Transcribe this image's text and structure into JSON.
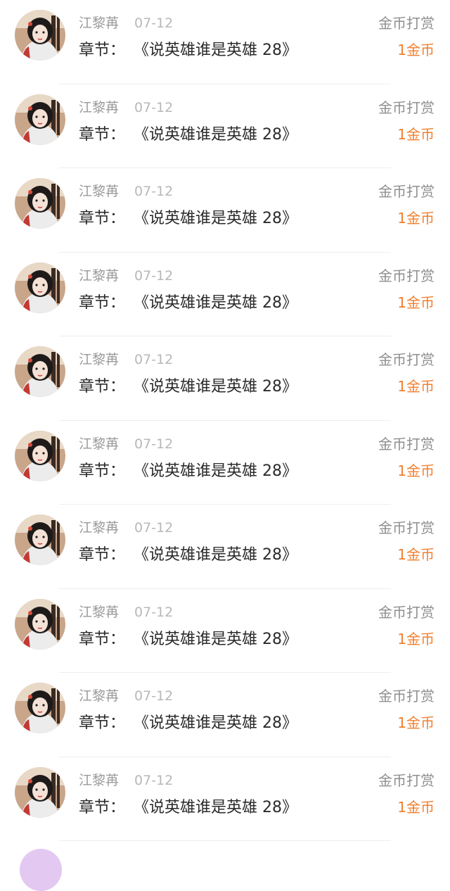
{
  "comments": [
    {
      "name": "江黎苒",
      "date": "07-12",
      "chapter_label": "章节：",
      "chapter_title": "《说英雄谁是英雄 28》",
      "action": "金币打赏",
      "amount": "1金币"
    },
    {
      "name": "江黎苒",
      "date": "07-12",
      "chapter_label": "章节：",
      "chapter_title": "《说英雄谁是英雄 28》",
      "action": "金币打赏",
      "amount": "1金币"
    },
    {
      "name": "江黎苒",
      "date": "07-12",
      "chapter_label": "章节：",
      "chapter_title": "《说英雄谁是英雄 28》",
      "action": "金币打赏",
      "amount": "1金币"
    },
    {
      "name": "江黎苒",
      "date": "07-12",
      "chapter_label": "章节：",
      "chapter_title": "《说英雄谁是英雄 28》",
      "action": "金币打赏",
      "amount": "1金币"
    },
    {
      "name": "江黎苒",
      "date": "07-12",
      "chapter_label": "章节：",
      "chapter_title": "《说英雄谁是英雄 28》",
      "action": "金币打赏",
      "amount": "1金币"
    },
    {
      "name": "江黎苒",
      "date": "07-12",
      "chapter_label": "章节：",
      "chapter_title": "《说英雄谁是英雄 28》",
      "action": "金币打赏",
      "amount": "1金币"
    },
    {
      "name": "江黎苒",
      "date": "07-12",
      "chapter_label": "章节：",
      "chapter_title": "《说英雄谁是英雄 28》",
      "action": "金币打赏",
      "amount": "1金币"
    },
    {
      "name": "江黎苒",
      "date": "07-12",
      "chapter_label": "章节：",
      "chapter_title": "《说英雄谁是英雄 28》",
      "action": "金币打赏",
      "amount": "1金币"
    },
    {
      "name": "江黎苒",
      "date": "07-12",
      "chapter_label": "章节：",
      "chapter_title": "《说英雄谁是英雄 28》",
      "action": "金币打赏",
      "amount": "1金币"
    },
    {
      "name": "江黎苒",
      "date": "07-12",
      "chapter_label": "章节：",
      "chapter_title": "《说英雄谁是英雄 28》",
      "action": "金币打赏",
      "amount": "1金币"
    }
  ],
  "colors": {
    "amount": "#f07f2f",
    "name": "#9a9a9a",
    "date": "#b8b8b8",
    "chapter": "#2b2b2b",
    "action": "#8e8e8e",
    "partial_avatar": "#e3c8f2"
  }
}
